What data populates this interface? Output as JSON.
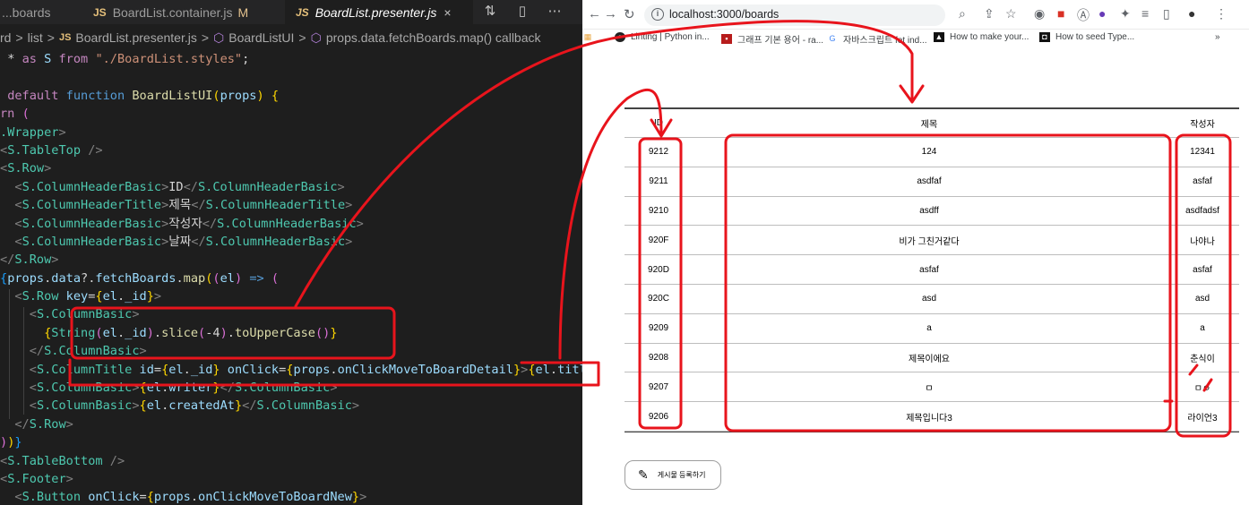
{
  "editor": {
    "tabs": [
      {
        "label": "...boards"
      },
      {
        "label": "BoardList.container.js",
        "modified": "M"
      },
      {
        "label": "BoardList.presenter.js",
        "close": "×"
      }
    ],
    "breadcrumb": [
      "rd",
      ">",
      "list",
      ">",
      "BoardList.presenter.js",
      ">",
      "BoardListUI",
      ">",
      "props.data.fetchBoards.map() callback"
    ]
  },
  "browser": {
    "url": "localhost:3000/boards",
    "bookmarks": [
      "Linting | Python in...",
      "그래프 기본 용어 - ra...",
      "자바스크립트 fet ind...",
      "How to make your...",
      "How to seed Type..."
    ]
  },
  "board": {
    "headers": {
      "id": "ID",
      "title": "제목",
      "writer": "작성자"
    },
    "rows": [
      {
        "id": "9212",
        "title": "124",
        "writer": "12341"
      },
      {
        "id": "9211",
        "title": "asdfaf",
        "writer": "asfaf"
      },
      {
        "id": "9210",
        "title": "asdff",
        "writer": "asdfadsf"
      },
      {
        "id": "920F",
        "title": "비가 그친거같다",
        "writer": "나야나"
      },
      {
        "id": "920D",
        "title": "asfaf",
        "writer": "asfaf"
      },
      {
        "id": "920C",
        "title": "asd",
        "writer": "asd"
      },
      {
        "id": "9209",
        "title": "a",
        "writer": "a"
      },
      {
        "id": "9208",
        "title": "제목이에요",
        "writer": "춘식이"
      },
      {
        "id": "9207",
        "title": "ㅁ",
        "writer": "ㅁㅇ"
      },
      {
        "id": "9206",
        "title": "제목입니다3",
        "writer": "라이언3"
      }
    ],
    "write_button": "게시물 등록하기"
  },
  "colors": {
    "annotation": "#e8141c",
    "editor_bg": "#1e1e1e"
  }
}
